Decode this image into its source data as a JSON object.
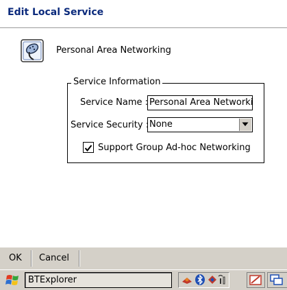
{
  "window": {
    "title": "Edit Local Service"
  },
  "service": {
    "display_name": "Personal Area Networking",
    "icon": "serial-plug-icon"
  },
  "group": {
    "legend": "Service Information",
    "name_label": "Service Name :",
    "name_value": "Personal Area Networki",
    "security_label": "Service Security :",
    "security_value": "None",
    "adhoc_label": "Support Group Ad-hoc Networking",
    "adhoc_checked": true
  },
  "menu": {
    "ok": "OK",
    "cancel": "Cancel"
  },
  "taskbar": {
    "app_label": "BTExplorer",
    "start_icon": "windows-flag-icon",
    "tray_icons": [
      "network-icon",
      "bluetooth-icon",
      "shield-icon",
      "signal-icon"
    ],
    "button_icons": [
      "input-panel-icon",
      "switch-window-icon"
    ]
  },
  "colors": {
    "title": "#0b2a7c",
    "bar": "#d4d0c8"
  }
}
